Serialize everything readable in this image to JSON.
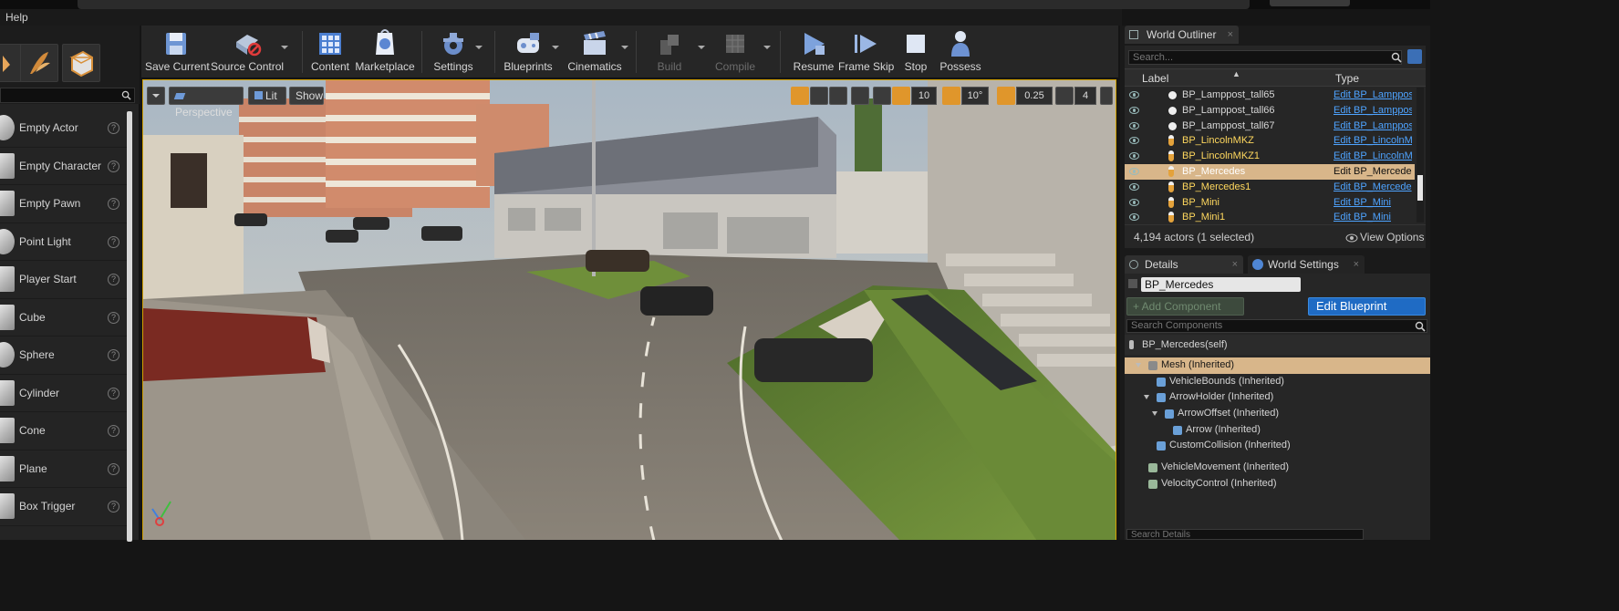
{
  "menubar": {
    "help_label": "Help"
  },
  "place_panel": {
    "items": [
      {
        "label": "Empty Actor",
        "icon": "sphere-icon"
      },
      {
        "label": "Empty Character",
        "icon": "character-icon"
      },
      {
        "label": "Empty Pawn",
        "icon": "pawn-icon"
      },
      {
        "label": "Point Light",
        "icon": "point-light-icon"
      },
      {
        "label": "Player Start",
        "icon": "player-start-icon"
      },
      {
        "label": "Cube",
        "icon": "cube-icon"
      },
      {
        "label": "Sphere",
        "icon": "sphere-icon"
      },
      {
        "label": "Cylinder",
        "icon": "cylinder-icon"
      },
      {
        "label": "Cone",
        "icon": "cone-icon"
      },
      {
        "label": "Plane",
        "icon": "plane-icon"
      },
      {
        "label": "Box Trigger",
        "icon": "box-trigger-icon"
      }
    ],
    "help_glyph": "?"
  },
  "toolbar": {
    "save_current": "Save Current",
    "source_control": "Source Control",
    "content": "Content",
    "marketplace": "Marketplace",
    "settings": "Settings",
    "blueprints": "Blueprints",
    "cinematics": "Cinematics",
    "build": "Build",
    "compile": "Compile",
    "resume": "Resume",
    "frame_skip": "Frame Skip",
    "stop": "Stop",
    "possess": "Possess"
  },
  "viewport": {
    "perspective_label": "Perspective",
    "lit_label": "Lit",
    "show_label": "Show",
    "grid_snap": "10",
    "rotation_snap": "10°",
    "scale_snap": "0.25",
    "camera_speed": "4"
  },
  "world_outliner": {
    "tab_label": "World Outliner",
    "close_glyph": "×",
    "search_placeholder": "Search...",
    "col_label": "Label",
    "col_type": "Type",
    "rows": [
      {
        "name": "BP_Lamppost_tall65",
        "type": "Edit BP_Lamppos",
        "kind": "light",
        "selected": false
      },
      {
        "name": "BP_Lamppost_tall66",
        "type": "Edit BP_Lamppos",
        "kind": "light",
        "selected": false
      },
      {
        "name": "BP_Lamppost_tall67",
        "type": "Edit BP_Lamppos",
        "kind": "light",
        "selected": false
      },
      {
        "name": "BP_LincolnMKZ",
        "type": "Edit BP_LincolnM",
        "kind": "pawn",
        "selected": false
      },
      {
        "name": "BP_LincolnMKZ1",
        "type": "Edit BP_LincolnM",
        "kind": "pawn",
        "selected": false
      },
      {
        "name": "BP_Mercedes",
        "type": "Edit BP_Mercede",
        "kind": "pawn",
        "selected": true
      },
      {
        "name": "BP_Mercedes1",
        "type": "Edit BP_Mercede",
        "kind": "pawn",
        "selected": false
      },
      {
        "name": "BP_Mini",
        "type": "Edit BP_Mini",
        "kind": "pawn",
        "selected": false
      },
      {
        "name": "BP_Mini1",
        "type": "Edit BP_Mini",
        "kind": "pawn",
        "selected": false
      }
    ],
    "actor_count": "4,194 actors (1 selected)",
    "view_options": "View Options"
  },
  "details": {
    "tab_label": "Details",
    "world_settings_tab": "World Settings",
    "close_glyph": "×",
    "object_name": "BP_Mercedes",
    "add_component": "+ Add Component",
    "edit_blueprint": "Edit Blueprint",
    "search_components_placeholder": "Search Components",
    "self_label": "BP_Mercedes(self)",
    "components": [
      {
        "label": "Mesh (Inherited)",
        "indent": 0,
        "expander": true,
        "selected": true,
        "icon_color": "#8a8a8a"
      },
      {
        "label": "VehicleBounds (Inherited)",
        "indent": 1,
        "expander": false,
        "selected": false,
        "icon_color": "#6aa0d8"
      },
      {
        "label": "ArrowHolder (Inherited)",
        "indent": 1,
        "expander": true,
        "selected": false,
        "icon_color": "#6aa0d8"
      },
      {
        "label": "ArrowOffset (Inherited)",
        "indent": 2,
        "expander": true,
        "selected": false,
        "icon_color": "#6aa0d8"
      },
      {
        "label": "Arrow (Inherited)",
        "indent": 3,
        "expander": false,
        "selected": false,
        "icon_color": "#6aa0d8"
      },
      {
        "label": "CustomCollision (Inherited)",
        "indent": 1,
        "expander": false,
        "selected": false,
        "icon_color": "#6aa0d8"
      },
      {
        "label": "VehicleMovement (Inherited)",
        "indent": 0,
        "expander": false,
        "selected": false,
        "icon_color": "#9ab89a",
        "gap": true
      },
      {
        "label": "VelocityControl (Inherited)",
        "indent": 0,
        "expander": false,
        "selected": false,
        "icon_color": "#9ab89a"
      }
    ],
    "search_details_placeholder": "Search Details"
  },
  "colors": {
    "accent_orange": "#e0962b",
    "selection": "#d8b68a",
    "link_blue": "#4ea3ff",
    "edit_blueprint_blue": "#1f6bc4",
    "viewport_border": "#d2a100"
  }
}
